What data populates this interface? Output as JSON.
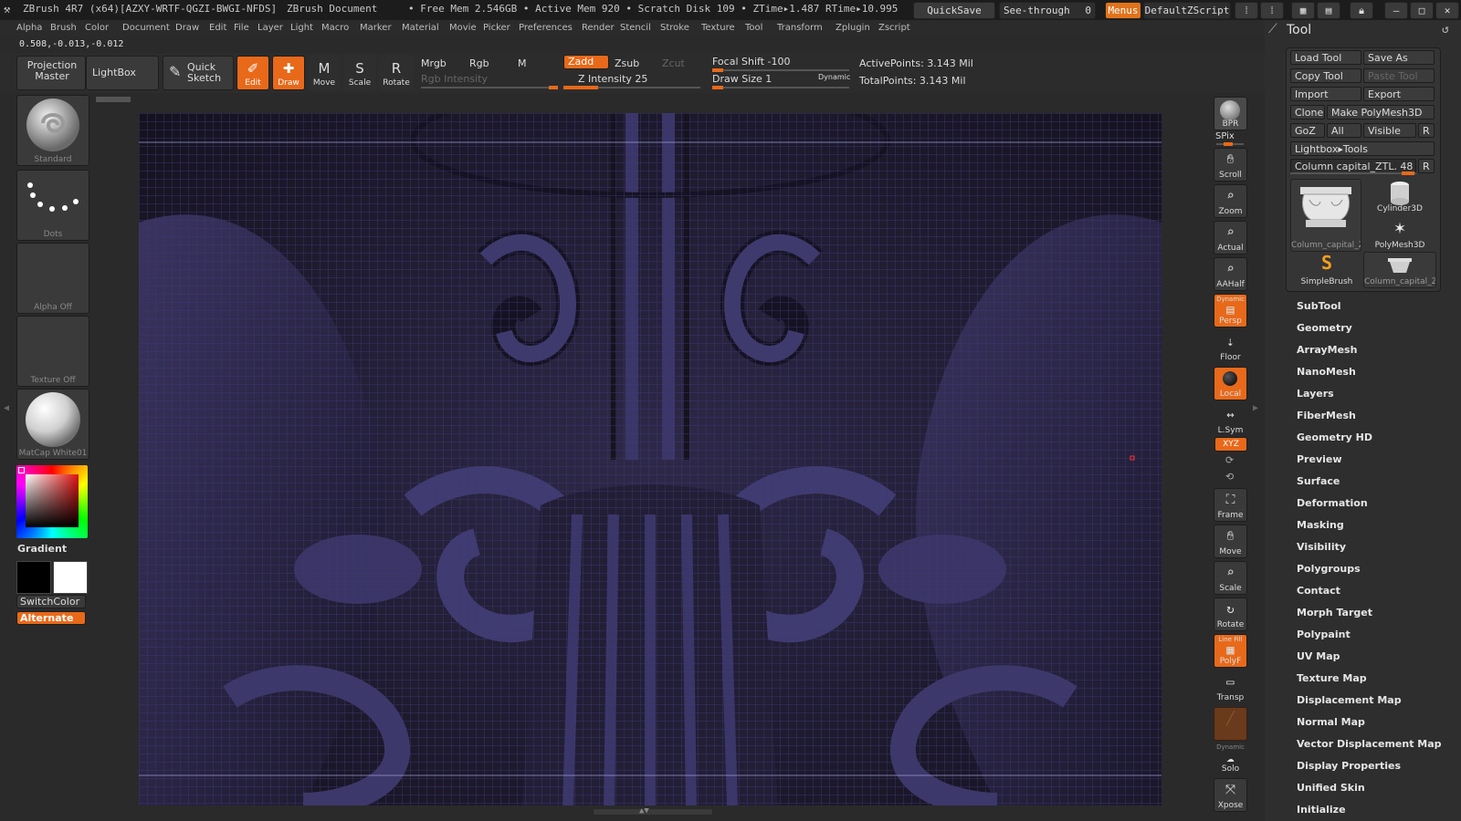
{
  "title_bar": {
    "app_title": "ZBrush 4R7 (x64)[AZXY-WRTF-QGZI-BWGI-NFDS]",
    "document": "ZBrush Document",
    "stats": "• Free Mem 2.546GB • Active Mem 920 • Scratch Disk 109 • ZTime▸1.487 RTime▸10.995",
    "quicksave": "QuickSave",
    "see_through": "See-through",
    "see_through_value": "0",
    "menus": "Menus",
    "default_zscript": "DefaultZScript"
  },
  "menu": [
    "Alpha",
    "Brush",
    "Color",
    "Document",
    "Draw",
    "Edit",
    "File",
    "Layer",
    "Light",
    "Macro",
    "Marker",
    "Material",
    "Movie",
    "Picker",
    "Preferences",
    "Render",
    "Stencil",
    "Stroke",
    "Texture",
    "Tool",
    "Transform",
    "Zplugin",
    "Zscript"
  ],
  "coords": "0.508,-0.013,-0.012",
  "toolbar": {
    "projection_master": "Projection Master",
    "lightbox": "LightBox",
    "quick_sketch": "Quick Sketch",
    "edit": "Edit",
    "draw": "Draw",
    "move": "Move",
    "scale": "Scale",
    "rotate": "Rotate",
    "mrgb": "Mrgb",
    "rgb": "Rgb",
    "m": "M",
    "rgb_intensity": "Rgb Intensity",
    "zadd": "Zadd",
    "zsub": "Zsub",
    "zcut": "Zcut",
    "z_intensity": "Z Intensity 25",
    "z_intensity_value": 0.25,
    "focal_shift": "Focal Shift -100",
    "draw_size": "Draw Size 1",
    "dynamic": "Dynamic",
    "active_points": "ActivePoints: 3.143 Mil",
    "total_points": "TotalPoints: 3.143 Mil"
  },
  "left": {
    "brush": "Standard",
    "stroke": "Dots",
    "alpha": "Alpha Off",
    "texture": "Texture Off",
    "material": "MatCap White01",
    "gradient": "Gradient",
    "switch_color": "SwitchColor",
    "alternate": "Alternate"
  },
  "shelf": [
    {
      "label": "BPR",
      "icon": "bpr-sphere-icon"
    },
    {
      "label": "Scroll",
      "icon": "hand-icon"
    },
    {
      "label": "Zoom",
      "icon": "zoom-icon"
    },
    {
      "label": "Actual",
      "icon": "actual-icon"
    },
    {
      "label": "AAHalf",
      "icon": "aahalf-icon"
    },
    {
      "label": "Persp",
      "icon": "persp-icon"
    },
    {
      "label": "Floor",
      "icon": "floor-icon"
    },
    {
      "label": "Local",
      "icon": "local-icon"
    },
    {
      "label": "L.Sym",
      "icon": "lsym-icon"
    },
    {
      "label": "Frame",
      "icon": "frame-icon"
    },
    {
      "label": "Move",
      "icon": "move-icon"
    },
    {
      "label": "Scale",
      "icon": "scale-icon"
    },
    {
      "label": "Rotate",
      "icon": "rotate-icon"
    },
    {
      "label": "PolyF",
      "icon": "polyf-icon"
    },
    {
      "label": "Transp",
      "icon": "transp-icon"
    },
    {
      "label": "Solo",
      "icon": "solo-icon"
    },
    {
      "label": "Xpose",
      "icon": "xpose-icon"
    }
  ],
  "shelf_extra": {
    "spix": "SPix",
    "dynamic": "Dynamic",
    "xyz": "XYZ",
    "line_fill": "Line Fill"
  },
  "tool": {
    "title": "Tool",
    "load_tool": "Load Tool",
    "save_as": "Save As",
    "copy_tool": "Copy Tool",
    "paste_tool": "Paste Tool",
    "import": "Import",
    "export": "Export",
    "clone": "Clone",
    "make_polymesh": "Make PolyMesh3D",
    "goz": "GoZ",
    "all": "All",
    "visible": "Visible",
    "r": "R",
    "lightbox_tools": "Lightbox▸Tools",
    "current_tool": "Column capital_ZTL. 48",
    "tiles": [
      "Column_capital_Z",
      "Cylinder3D",
      "PolyMesh3D",
      "SimpleBrush",
      "Column_capital_Z"
    ],
    "sections": [
      "SubTool",
      "Geometry",
      "ArrayMesh",
      "NanoMesh",
      "Layers",
      "FiberMesh",
      "Geometry HD",
      "Preview",
      "Surface",
      "Deformation",
      "Masking",
      "Visibility",
      "Polygroups",
      "Contact",
      "Morph Target",
      "Polypaint",
      "UV Map",
      "Texture Map",
      "Displacement Map",
      "Normal Map",
      "Vector Displacement Map",
      "Display Properties",
      "Unified Skin",
      "Initialize"
    ]
  },
  "colors": {
    "accent": "#e8691a",
    "viewport": "#26223c",
    "mesh": "#3a3570"
  }
}
